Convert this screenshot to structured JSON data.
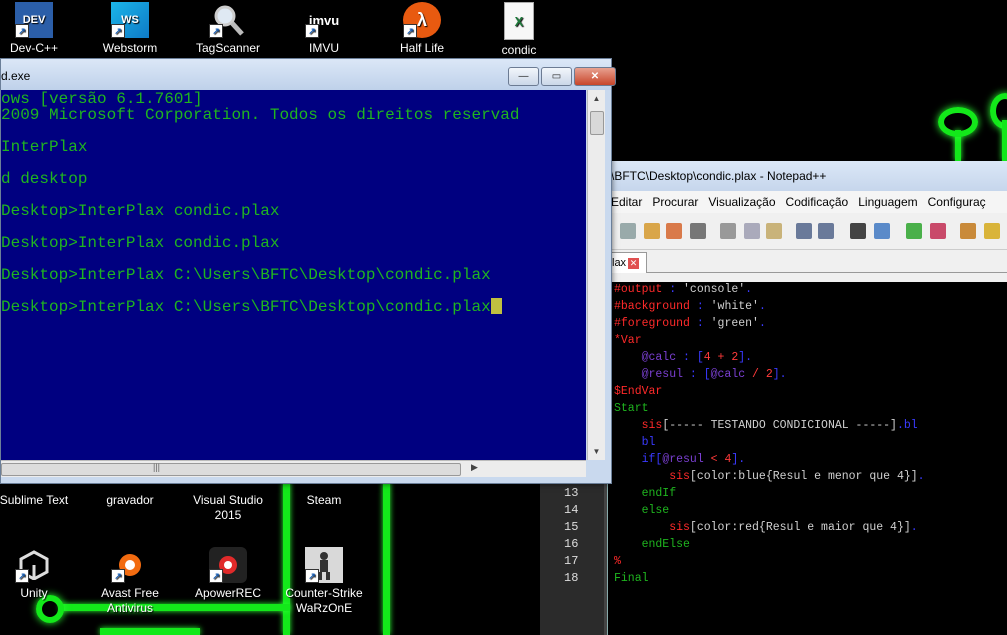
{
  "desktop_icons": [
    {
      "label": "Dev-C++",
      "icon": "devcpp-icon",
      "badge": "DEV"
    },
    {
      "label": "Webstorm",
      "icon": "webstorm-icon",
      "badge": "WS"
    },
    {
      "label": "TagScanner",
      "icon": "magnifier-icon",
      "badge": ""
    },
    {
      "label": "IMVU",
      "icon": "imvu-icon",
      "badge": "imvu"
    },
    {
      "label": "Half Life",
      "icon": "lambda-icon",
      "badge": "λ"
    },
    {
      "label": "condic",
      "icon": "excel-file-icon",
      "badge": "X"
    },
    {
      "label": "Sublime Text",
      "icon": "sublime-icon",
      "badge": ""
    },
    {
      "label": "gravador",
      "icon": "recorder-icon",
      "badge": ""
    },
    {
      "label": "Visual Studio 2015",
      "icon": "visualstudio-icon",
      "badge": ""
    },
    {
      "label": "Steam",
      "icon": "steam-icon",
      "badge": ""
    },
    {
      "label": "Unity",
      "icon": "unity-icon",
      "badge": ""
    },
    {
      "label": "Avast Free Antivirus",
      "icon": "avast-icon",
      "badge": ""
    },
    {
      "label": "ApowerREC",
      "icon": "apowerrec-icon",
      "badge": ""
    },
    {
      "label": "Counter-Strike WaRzOnE",
      "icon": "counterstrike-icon",
      "badge": ""
    }
  ],
  "cmd": {
    "title": "d.exe",
    "lines": [
      "ows [versão 6.1.7601]",
      "2009 Microsoft Corporation. Todos os direitos reservad",
      "",
      "InterPlax",
      "",
      "d desktop",
      "",
      "Desktop>InterPlax condic.plax",
      "",
      "Desktop>InterPlax condic.plax",
      "",
      "Desktop>InterPlax C:\\Users\\BFTC\\Desktop\\condic.plax",
      "",
      "Desktop>InterPlax C:\\Users\\BFTC\\Desktop\\condic.plax"
    ],
    "text_color": "#1fb51f",
    "background": "#000080"
  },
  "npp": {
    "title": "\\BFTC\\Desktop\\condic.plax - Notepad++",
    "menu": [
      "Editar",
      "Procurar",
      "Visualização",
      "Codificação",
      "Linguagem",
      "Configuraç"
    ],
    "tab": "lax",
    "code": [
      [
        {
          "t": "#output",
          "c": "#ff2a2a"
        },
        {
          "t": " : ",
          "c": "#3a3aff"
        },
        {
          "t": "'console'",
          "c": "#d0d0d0"
        },
        {
          "t": ".",
          "c": "#3a3aff"
        }
      ],
      [
        {
          "t": "#background",
          "c": "#ff2a2a"
        },
        {
          "t": " : ",
          "c": "#3a3aff"
        },
        {
          "t": "'white'",
          "c": "#d0d0d0"
        },
        {
          "t": ".",
          "c": "#3a3aff"
        }
      ],
      [
        {
          "t": "#foreground",
          "c": "#ff2a2a"
        },
        {
          "t": " : ",
          "c": "#3a3aff"
        },
        {
          "t": "'green'",
          "c": "#d0d0d0"
        },
        {
          "t": ".",
          "c": "#3a3aff"
        }
      ],
      [
        {
          "t": "*Var",
          "c": "#ff2a2a"
        }
      ],
      [
        {
          "t": "    @calc",
          "c": "#7a3fd1"
        },
        {
          "t": " : [",
          "c": "#3a3aff"
        },
        {
          "t": "4 + 2",
          "c": "#ff3a3a"
        },
        {
          "t": "].",
          "c": "#3a3aff"
        }
      ],
      [
        {
          "t": "    @resul",
          "c": "#7a3fd1"
        },
        {
          "t": " : [",
          "c": "#3a3aff"
        },
        {
          "t": "@calc",
          "c": "#7a3fd1"
        },
        {
          "t": " / ",
          "c": "#ff3a3a"
        },
        {
          "t": "2",
          "c": "#ff3a3a"
        },
        {
          "t": "].",
          "c": "#3a3aff"
        }
      ],
      [
        {
          "t": "$EndVar",
          "c": "#ff2a2a"
        }
      ],
      [
        {
          "t": "Start",
          "c": "#1fb51f"
        }
      ],
      [
        {
          "t": "    sis",
          "c": "#ff2a2a"
        },
        {
          "t": "[----- TESTANDO CONDICIONAL -----]",
          "c": "#d0d0d0"
        },
        {
          "t": ".bl",
          "c": "#3a3aff"
        }
      ],
      [
        {
          "t": "    bl",
          "c": "#3a3aff"
        }
      ],
      [
        {
          "t": "    if[",
          "c": "#3a3aff"
        },
        {
          "t": "@resul",
          "c": "#7a3fd1"
        },
        {
          "t": " < ",
          "c": "#ff3a3a"
        },
        {
          "t": "4",
          "c": "#ff3a3a"
        },
        {
          "t": "].",
          "c": "#3a3aff"
        }
      ],
      [
        {
          "t": "        sis",
          "c": "#ff2a2a"
        },
        {
          "t": "[color:blue{Resul e menor que 4}]",
          "c": "#d0d0d0"
        },
        {
          "t": ".",
          "c": "#3a3aff"
        }
      ],
      [
        {
          "t": "    endIf",
          "c": "#1fb51f"
        }
      ],
      [
        {
          "t": "    else",
          "c": "#1fb51f"
        }
      ],
      [
        {
          "t": "        sis",
          "c": "#ff2a2a"
        },
        {
          "t": "[color:red{Resul e maior que 4}]",
          "c": "#d0d0d0"
        },
        {
          "t": ".",
          "c": "#3a3aff"
        }
      ],
      [
        {
          "t": "    endElse",
          "c": "#1fb51f"
        }
      ],
      [
        {
          "t": "%",
          "c": "#ff2a2a"
        }
      ],
      [
        {
          "t": "Final",
          "c": "#1fb51f"
        }
      ]
    ],
    "visible_line_numbers": [
      "13",
      "14",
      "15",
      "16",
      "17",
      "18"
    ]
  }
}
